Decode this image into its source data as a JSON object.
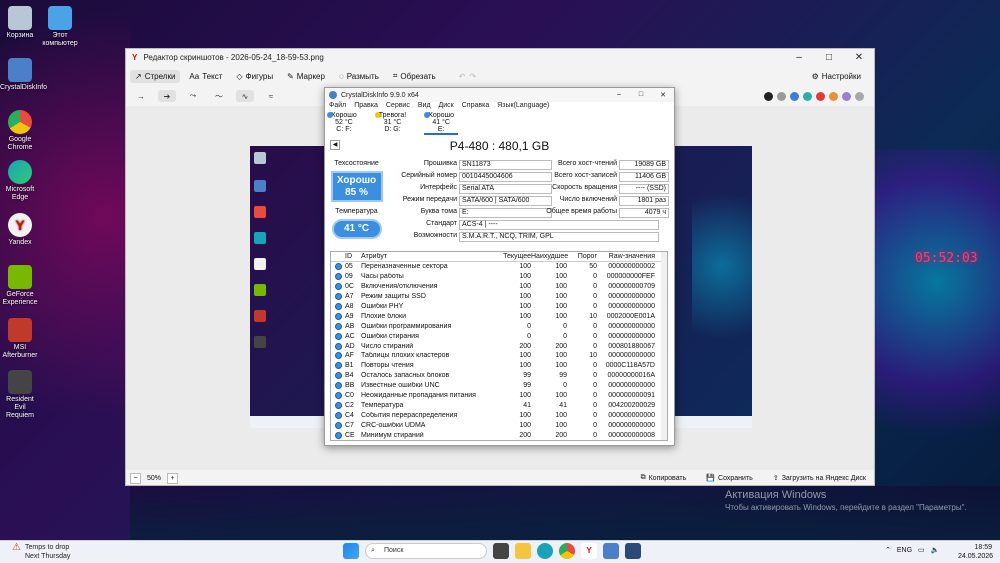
{
  "desktop": {
    "icons": [
      {
        "label": "Корзина",
        "color": "#b7c7d6"
      },
      {
        "label": "Этот компьютер",
        "color": "#4aa3e6"
      },
      {
        "label": "CrystalDiskInfo",
        "color": "#4b7fc8"
      },
      {
        "label": "Google Chrome",
        "color": "#e74c3c"
      },
      {
        "label": "Microsoft Edge",
        "color": "#1aa3b8"
      },
      {
        "label": "Yandex",
        "color": "#f2f2f2"
      },
      {
        "label": "GeForce Experience",
        "color": "#76b900"
      },
      {
        "label": "MSI Afterburner",
        "color": "#c0392b"
      },
      {
        "label": "Resident Evil Requiem",
        "color": "#444444"
      }
    ],
    "wallpaper_clock": "05:52:03",
    "activation": {
      "title": "Активация Windows",
      "text": "Чтобы активировать Windows, перейдите в раздел \"Параметры\"."
    }
  },
  "editor": {
    "title": "Редактор скриншотов - 2026-05-24_18-59-53.png",
    "tools": [
      "Стрелки",
      "Текст",
      "Фигуры",
      "Маркер",
      "Размыть",
      "Обрезать"
    ],
    "settings_label": "Настройки",
    "swatch_colors": [
      "#222222",
      "#9a9a9a",
      "#3b7dd8",
      "#2bb0a8",
      "#e03b3b",
      "#e8913a",
      "#9b7fd1",
      "#a8a8a8"
    ],
    "zoom": "50%",
    "bottom_actions": [
      "Копировать",
      "Сохранить",
      "Загрузить на Яндекс Диск"
    ]
  },
  "cdi": {
    "title": "CrystalDiskInfo 9.9.0 x64",
    "menu": [
      "Файл",
      "Правка",
      "Сервис",
      "Вид",
      "Диск",
      "Справка",
      "Язык(Language)"
    ],
    "disks": [
      {
        "status": "Хорошо",
        "temp": "52 °C",
        "letters": "C: F:",
        "color": "#3b8fde"
      },
      {
        "status": "Тревога!",
        "temp": "31 °C",
        "letters": "D: G:",
        "color": "#f1c40f"
      },
      {
        "status": "Хорошо",
        "temp": "41 °C",
        "letters": "E:",
        "color": "#3b8fde"
      }
    ],
    "model": "P4-480 : 480,1 GB",
    "health_label": "Техсостояние",
    "health_status": "Хорошо",
    "health_percent": "85 %",
    "temp_label": "Температура",
    "temp_value": "41 °C",
    "info": {
      "firmware_label": "Прошивка",
      "firmware": "SN11873",
      "serial_label": "Серийный номер",
      "serial": "0010445004606",
      "interface_label": "Интерфейс",
      "interface": "Serial ATA",
      "transfer_label": "Режим передачи",
      "transfer": "SATA/600 | SATA/600",
      "letter_label": "Буква тома",
      "letter": "E:",
      "standard_label": "Стандарт",
      "standard": "ACS-4 | ----",
      "features_label": "Возможности",
      "features": "S.M.A.R.T., NCQ, TRIM, GPL",
      "host_reads_label": "Всего хост-чтений",
      "host_reads": "19089 GB",
      "host_writes_label": "Всего хост-записей",
      "host_writes": "11406 GB",
      "rotation_label": "Скорость вращения",
      "rotation": "---- (SSD)",
      "power_count_label": "Число включений",
      "power_count": "1801 раз",
      "power_hours_label": "Общее время работы",
      "power_hours": "4079 ч"
    },
    "columns": [
      "ID",
      "Атрибут",
      "Текущее",
      "Наихудшее",
      "Порог",
      "Raw-значения"
    ],
    "rows": [
      [
        "05",
        "Переназначенные сектора",
        "100",
        "100",
        "50",
        "000000000002"
      ],
      [
        "09",
        "Часы работы",
        "100",
        "100",
        "0",
        "000000000FEF"
      ],
      [
        "0C",
        "Включения/отключения",
        "100",
        "100",
        "0",
        "000000000709"
      ],
      [
        "A7",
        "Режим защиты SSD",
        "100",
        "100",
        "0",
        "000000000000"
      ],
      [
        "A8",
        "Ошибки PHY",
        "100",
        "100",
        "0",
        "000000000000"
      ],
      [
        "A9",
        "Плохие блоки",
        "100",
        "100",
        "10",
        "0002000E001A"
      ],
      [
        "AB",
        "Ошибки программирования",
        "0",
        "0",
        "0",
        "000000000000"
      ],
      [
        "AC",
        "Ошибки стирания",
        "0",
        "0",
        "0",
        "000000000000"
      ],
      [
        "AD",
        "Число стираний",
        "200",
        "200",
        "0",
        "000801880067"
      ],
      [
        "AF",
        "Таблицы плохих кластеров",
        "100",
        "100",
        "10",
        "000000000000"
      ],
      [
        "B1",
        "Повторы чтения",
        "100",
        "100",
        "0",
        "0000C118A57D"
      ],
      [
        "B4",
        "Осталось запасных блоков",
        "99",
        "99",
        "0",
        "00000000016A"
      ],
      [
        "BB",
        "Известные ошибки UNC",
        "99",
        "0",
        "0",
        "000000000000"
      ],
      [
        "C0",
        "Неожиданные пропадания питания",
        "100",
        "100",
        "0",
        "000000000091"
      ],
      [
        "C2",
        "Температура",
        "41",
        "41",
        "0",
        "004200200029"
      ],
      [
        "C4",
        "События перераспределения",
        "100",
        "100",
        "0",
        "000000000000"
      ],
      [
        "C7",
        "CRC-ошибки UDMA",
        "100",
        "100",
        "0",
        "000000000000"
      ],
      [
        "CE",
        "Минимум стираний",
        "200",
        "200",
        "0",
        "000000000008"
      ]
    ]
  },
  "taskbar": {
    "weather_title": "Temps to drop",
    "weather_sub": "Next Thursday",
    "search_placeholder": "Поиск",
    "lang": "ENG",
    "time": "18:59",
    "date": "24.05.2026"
  }
}
